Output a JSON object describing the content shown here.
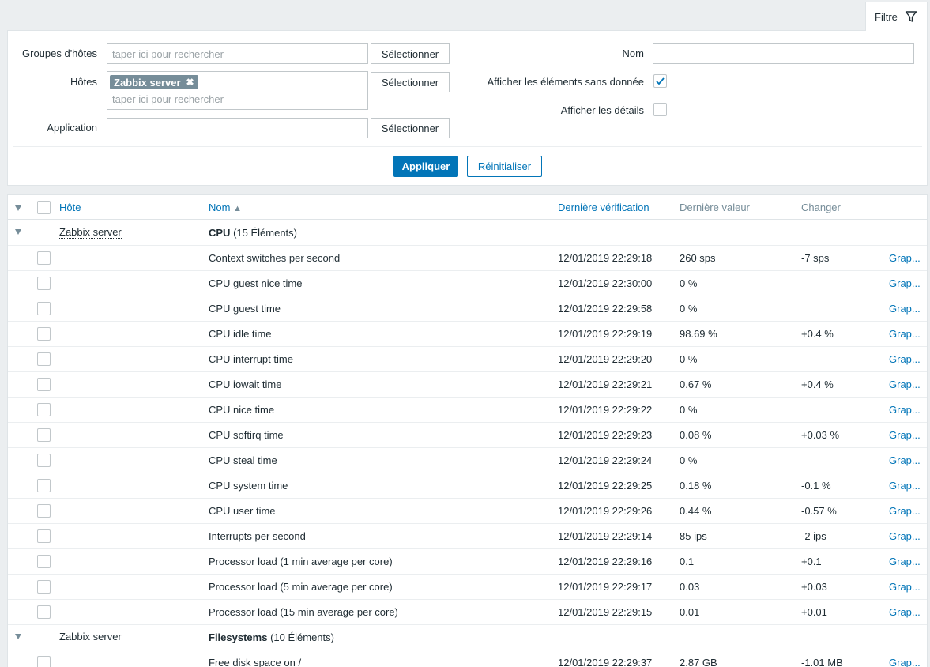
{
  "filter": {
    "tab_label": "Filtre",
    "host_groups_label": "Groupes d'hôtes",
    "hosts_label": "Hôtes",
    "application_label": "Application",
    "search_placeholder": "taper ici pour rechercher",
    "select_label": "Sélectionner",
    "host_tag": "Zabbix server",
    "name_label": "Nom",
    "name_value": "",
    "show_without_data_label": "Afficher les éléments sans donnée",
    "show_details_label": "Afficher les détails",
    "apply_label": "Appliquer",
    "reset_label": "Réinitialiser"
  },
  "table": {
    "headers": {
      "host": "Hôte",
      "name": "Nom",
      "sort_arrow": "▲",
      "last_check": "Dernière vérification",
      "last_value": "Dernière valeur",
      "change": "Changer"
    },
    "groups": [
      {
        "host": "Zabbix server",
        "name": "CPU",
        "count": "(15 Éléments)"
      },
      {
        "host": "Zabbix server",
        "name": "Filesystems",
        "count": "(10 Éléments)"
      }
    ],
    "graph_label": "Grap...",
    "rows": [
      {
        "name": "Context switches per second",
        "last_check": "12/01/2019 22:29:18",
        "last_value": "260 sps",
        "change": "-7 sps"
      },
      {
        "name": "CPU guest nice time",
        "last_check": "12/01/2019 22:30:00",
        "last_value": "0 %",
        "change": ""
      },
      {
        "name": "CPU guest time",
        "last_check": "12/01/2019 22:29:58",
        "last_value": "0 %",
        "change": ""
      },
      {
        "name": "CPU idle time",
        "last_check": "12/01/2019 22:29:19",
        "last_value": "98.69 %",
        "change": "+0.4 %"
      },
      {
        "name": "CPU interrupt time",
        "last_check": "12/01/2019 22:29:20",
        "last_value": "0 %",
        "change": ""
      },
      {
        "name": "CPU iowait time",
        "last_check": "12/01/2019 22:29:21",
        "last_value": "0.67 %",
        "change": "+0.4 %"
      },
      {
        "name": "CPU nice time",
        "last_check": "12/01/2019 22:29:22",
        "last_value": "0 %",
        "change": ""
      },
      {
        "name": "CPU softirq time",
        "last_check": "12/01/2019 22:29:23",
        "last_value": "0.08 %",
        "change": "+0.03 %"
      },
      {
        "name": "CPU steal time",
        "last_check": "12/01/2019 22:29:24",
        "last_value": "0 %",
        "change": ""
      },
      {
        "name": "CPU system time",
        "last_check": "12/01/2019 22:29:25",
        "last_value": "0.18 %",
        "change": "-0.1 %"
      },
      {
        "name": "CPU user time",
        "last_check": "12/01/2019 22:29:26",
        "last_value": "0.44 %",
        "change": "-0.57 %"
      },
      {
        "name": "Interrupts per second",
        "last_check": "12/01/2019 22:29:14",
        "last_value": "85 ips",
        "change": "-2 ips"
      },
      {
        "name": "Processor load (1 min average per core)",
        "last_check": "12/01/2019 22:29:16",
        "last_value": "0.1",
        "change": "+0.1"
      },
      {
        "name": "Processor load (5 min average per core)",
        "last_check": "12/01/2019 22:29:17",
        "last_value": "0.03",
        "change": "+0.03"
      },
      {
        "name": "Processor load (15 min average per core)",
        "last_check": "12/01/2019 22:29:15",
        "last_value": "0.01",
        "change": "+0.01"
      },
      {
        "name": "Free disk space on /",
        "last_check": "12/01/2019 22:29:37",
        "last_value": "2.87 GB",
        "change": "-1.01 MB"
      }
    ]
  },
  "colors": {
    "accent": "#0275b8",
    "tag_bg": "#768d99",
    "page_bg": "#ebeef0"
  }
}
